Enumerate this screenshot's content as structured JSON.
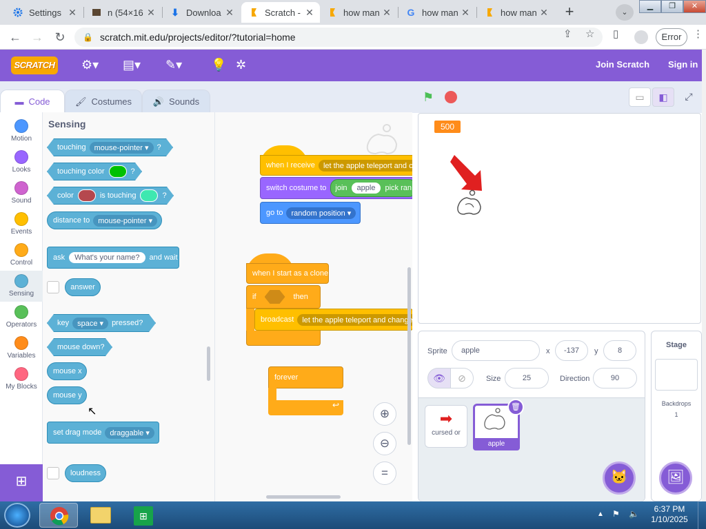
{
  "browser": {
    "tabs": [
      {
        "title": "Settings",
        "icon": "gear-icon",
        "icon_color": "#1a73e8"
      },
      {
        "title": "n (54×16",
        "icon": "image-icon",
        "icon_color": "#444444"
      },
      {
        "title": "Downloa",
        "icon": "download-icon",
        "icon_color": "#1a73e8"
      },
      {
        "title": "Scratch -",
        "icon": "scratch-icon",
        "icon_color": "#f7a800"
      },
      {
        "title": "how man",
        "icon": "scratch-icon",
        "icon_color": "#f7a800"
      },
      {
        "title": "how man",
        "icon": "google-icon",
        "icon_color": "#4285f4"
      },
      {
        "title": "how man",
        "icon": "scratch-icon",
        "icon_color": "#f7a800"
      }
    ],
    "url": "scratch.mit.edu/projects/editor/?tutorial=home",
    "error_label": "Error"
  },
  "menubar": {
    "logo": "SCRATCH",
    "join": "Join Scratch",
    "sign_in": "Sign in"
  },
  "editor_tabs": {
    "code": "Code",
    "costumes": "Costumes",
    "sounds": "Sounds"
  },
  "categories": [
    {
      "label": "Motion",
      "color": "#4c97ff"
    },
    {
      "label": "Looks",
      "color": "#9966ff"
    },
    {
      "label": "Sound",
      "color": "#cf63cf"
    },
    {
      "label": "Events",
      "color": "#ffbf00"
    },
    {
      "label": "Control",
      "color": "#ffab19"
    },
    {
      "label": "Sensing",
      "color": "#5cb1d6"
    },
    {
      "label": "Operators",
      "color": "#59c059"
    },
    {
      "label": "Variables",
      "color": "#ff8c1a"
    },
    {
      "label": "My Blocks",
      "color": "#ff6680"
    }
  ],
  "palette": {
    "heading": "Sensing",
    "touching": "touching",
    "touching_opt": "mouse-pointer",
    "qmark": "?",
    "touching_color": "touching color",
    "color": "color",
    "is_touching": "is touching",
    "distance_to": "distance to",
    "distance_opt": "mouse-pointer",
    "ask": "ask",
    "ask_default": "What's your name?",
    "and_wait": "and wait",
    "answer": "answer",
    "key": "key",
    "key_opt": "space",
    "pressed": "pressed?",
    "mouse_down": "mouse down?",
    "mouse_x": "mouse x",
    "mouse_y": "mouse y",
    "set_drag_mode": "set drag mode",
    "drag_opt": "draggable",
    "loudness": "loudness",
    "swatch_green": "#00c000",
    "swatch_brown": "#b5484e",
    "swatch_teal": "#3ee8b0"
  },
  "workspace": {
    "when_i_receive": "when I receive",
    "receive_msg": "let the apple teleport and ch",
    "switch_costume": "switch costume to",
    "join": "join",
    "join_arg": "apple",
    "pick_random": "pick ran",
    "go_to": "go to",
    "go_to_opt": "random position",
    "when_clone": "when I start as a clone",
    "if": "if",
    "then": "then",
    "broadcast": "broadcast",
    "broadcast_msg": "let the apple teleport and change",
    "forever": "forever"
  },
  "stage": {
    "monitor_value": "500"
  },
  "sprite_info": {
    "sprite_label": "Sprite",
    "sprite_name": "apple",
    "x_label": "x",
    "x_value": "-137",
    "y_label": "y",
    "y_value": "8",
    "size_label": "Size",
    "size_value": "25",
    "direction_label": "Direction",
    "direction_value": "90"
  },
  "sprites": [
    {
      "name": "cursed or"
    },
    {
      "name": "apple"
    }
  ],
  "stage_panel": {
    "title": "Stage",
    "backdrops_label": "Backdrops",
    "backdrops_count": "1"
  },
  "taskbar": {
    "time": "6:37 PM",
    "date": "1/10/2025"
  }
}
